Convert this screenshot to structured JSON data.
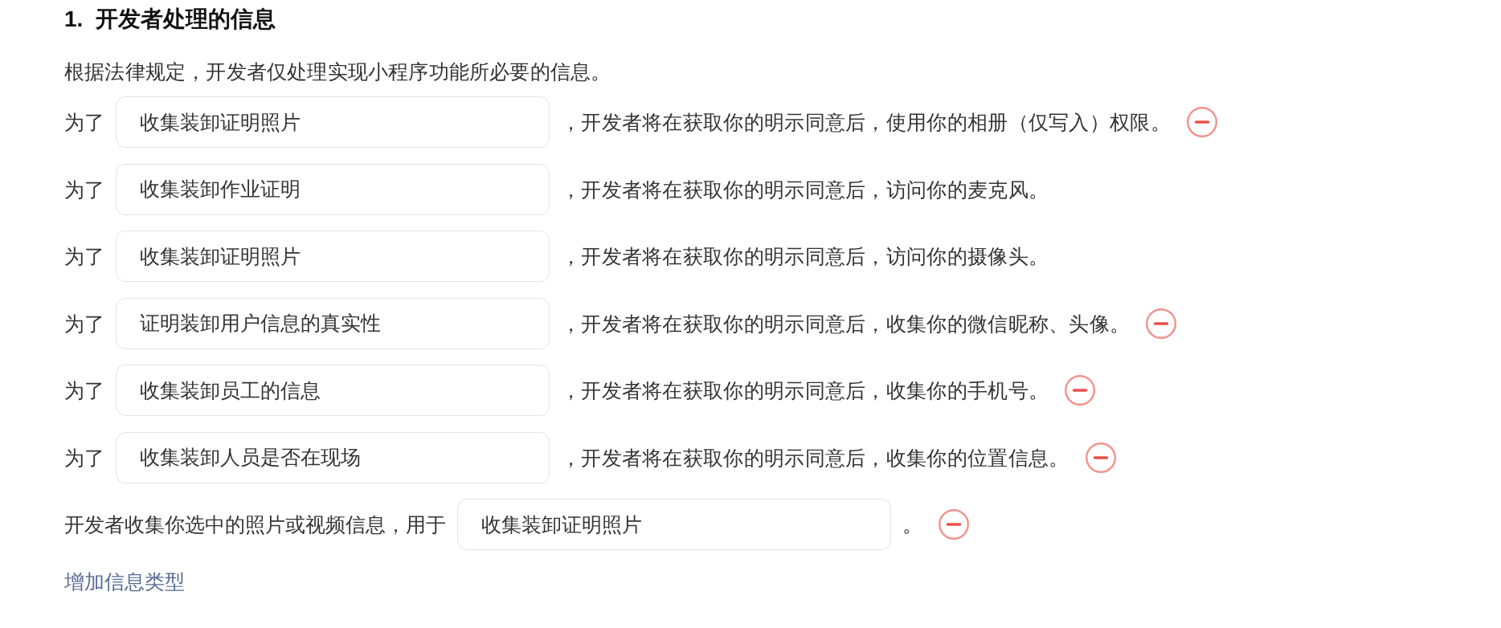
{
  "heading": {
    "number": "1.",
    "title": "开发者处理的信息"
  },
  "intro": "根据法律规定，开发者仅处理实现小程序功能所必要的信息。",
  "rows": [
    {
      "prefix": "为了",
      "value": "收集装卸证明照片",
      "suffix": "，开发者将在获取你的明示同意后，使用你的相册（仅写入）权限。",
      "removable": true
    },
    {
      "prefix": "为了",
      "value": "收集装卸作业证明",
      "suffix": "，开发者将在获取你的明示同意后，访问你的麦克风。",
      "removable": false
    },
    {
      "prefix": "为了",
      "value": "收集装卸证明照片",
      "suffix": "，开发者将在获取你的明示同意后，访问你的摄像头。",
      "removable": false
    },
    {
      "prefix": "为了",
      "value": "证明装卸用户信息的真实性",
      "suffix": "，开发者将在获取你的明示同意后，收集你的微信昵称、头像。",
      "removable": true
    },
    {
      "prefix": "为了",
      "value": "收集装卸员工的信息",
      "suffix": "，开发者将在获取你的明示同意后，收集你的手机号。",
      "removable": true
    },
    {
      "prefix": "为了",
      "value": "收集装卸人员是否在现场",
      "suffix": "，开发者将在获取你的明示同意后，收集你的位置信息。",
      "removable": true
    },
    {
      "prefix": "开发者收集你选中的照片或视频信息，用于",
      "value": "收集装卸证明照片",
      "suffix": "。",
      "removable": true
    }
  ],
  "add_link": "增加信息类型"
}
